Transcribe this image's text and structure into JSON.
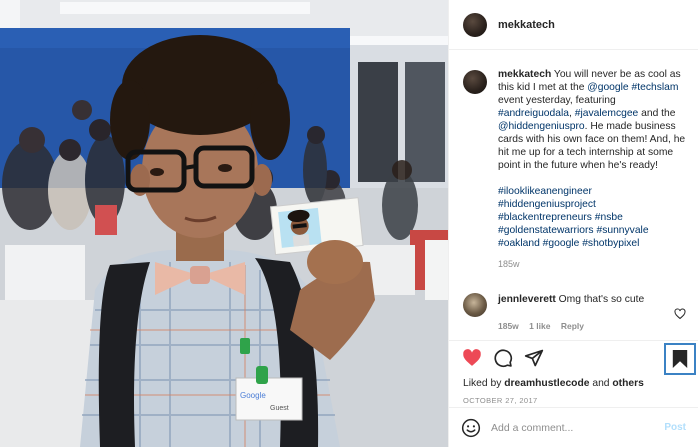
{
  "header": {
    "username": "mekkatech"
  },
  "caption": {
    "username": "mekkatech",
    "text_1": " You will never be as cool as this kid I met at the ",
    "mention_google": "@google",
    "text_2": " ",
    "tag_techslam": "#techslam",
    "text_3": " event yesterday, featuring ",
    "tag_andreiguodala": "#andreiguodala",
    "text_4": ", ",
    "tag_javalemcgee": "#javalemcgee",
    "text_5": " and the ",
    "mention_hiddengenius": "@hiddengeniuspro",
    "text_6": ". He made business cards with his own face on them! And, he hit me up for a tech internship at some point in the future when he's ready!",
    "hashtags": [
      "#ilooklikeanengineer",
      "#hiddengeniusproject",
      "#blackentrepreneurs",
      "#nsbe",
      "#goldenstatewarriors",
      "#sunnyvale",
      "#oakland",
      "#google",
      "#shotbypixel"
    ],
    "time": "185w"
  },
  "reply": {
    "username": "jennleverett",
    "text": " Omg that's so cute",
    "time": "185w",
    "likes": "1 like",
    "reply_label": "Reply"
  },
  "likes": {
    "prefix": "Liked by ",
    "user": "dreamhustlecode",
    "middle": " and ",
    "others": "others"
  },
  "date": "OCTOBER 27, 2017",
  "add_comment": {
    "placeholder": "Add a comment...",
    "post_label": "Post"
  },
  "photo": {
    "badge_brand": "Google",
    "badge_name": "Guest"
  },
  "icons": {
    "like": "heart-filled-icon",
    "comment": "comment-icon",
    "share": "share-icon",
    "save": "bookmark-icon",
    "emoji": "emoji-icon",
    "reply_like": "heart-outline-icon"
  },
  "colors": {
    "like_red": "#ed4956",
    "link": "#003569",
    "muted": "#8e8e8e",
    "post_disabled": "#b2dffc"
  }
}
